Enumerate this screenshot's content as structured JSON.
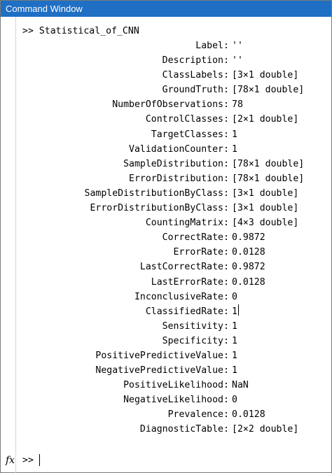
{
  "window": {
    "title": "Command Window"
  },
  "command": {
    "prompt": ">>",
    "text": "Statistical_of_CNN"
  },
  "fields": [
    {
      "key": "Label",
      "value": "''"
    },
    {
      "key": "Description",
      "value": "''"
    },
    {
      "key": "ClassLabels",
      "value": "[3×1 double]"
    },
    {
      "key": "GroundTruth",
      "value": "[78×1 double]"
    },
    {
      "key": "NumberOfObservations",
      "value": "78"
    },
    {
      "key": "ControlClasses",
      "value": "[2×1 double]"
    },
    {
      "key": "TargetClasses",
      "value": "1"
    },
    {
      "key": "ValidationCounter",
      "value": "1"
    },
    {
      "key": "SampleDistribution",
      "value": "[78×1 double]"
    },
    {
      "key": "ErrorDistribution",
      "value": "[78×1 double]"
    },
    {
      "key": "SampleDistributionByClass",
      "value": "[3×1 double]"
    },
    {
      "key": "ErrorDistributionByClass",
      "value": "[3×1 double]"
    },
    {
      "key": "CountingMatrix",
      "value": "[4×3 double]"
    },
    {
      "key": "CorrectRate",
      "value": "0.9872"
    },
    {
      "key": "ErrorRate",
      "value": "0.0128"
    },
    {
      "key": "LastCorrectRate",
      "value": "0.9872"
    },
    {
      "key": "LastErrorRate",
      "value": "0.0128"
    },
    {
      "key": "InconclusiveRate",
      "value": "0"
    },
    {
      "key": "ClassifiedRate",
      "value": "1"
    },
    {
      "key": "Sensitivity",
      "value": "1"
    },
    {
      "key": "Specificity",
      "value": "1"
    },
    {
      "key": "PositivePredictiveValue",
      "value": "1"
    },
    {
      "key": "NegativePredictiveValue",
      "value": "1"
    },
    {
      "key": "PositiveLikelihood",
      "value": "NaN"
    },
    {
      "key": "NegativeLikelihood",
      "value": "0"
    },
    {
      "key": "Prevalence",
      "value": "0.0128"
    },
    {
      "key": "DiagnosticTable",
      "value": "[2×2 double]"
    }
  ],
  "bottom": {
    "fx_label": "fx",
    "prompt": ">>"
  },
  "colors": {
    "titlebar": "#1f6fc4",
    "title_text": "#ffffff"
  },
  "icons": {
    "fx": "function-fx-icon"
  }
}
